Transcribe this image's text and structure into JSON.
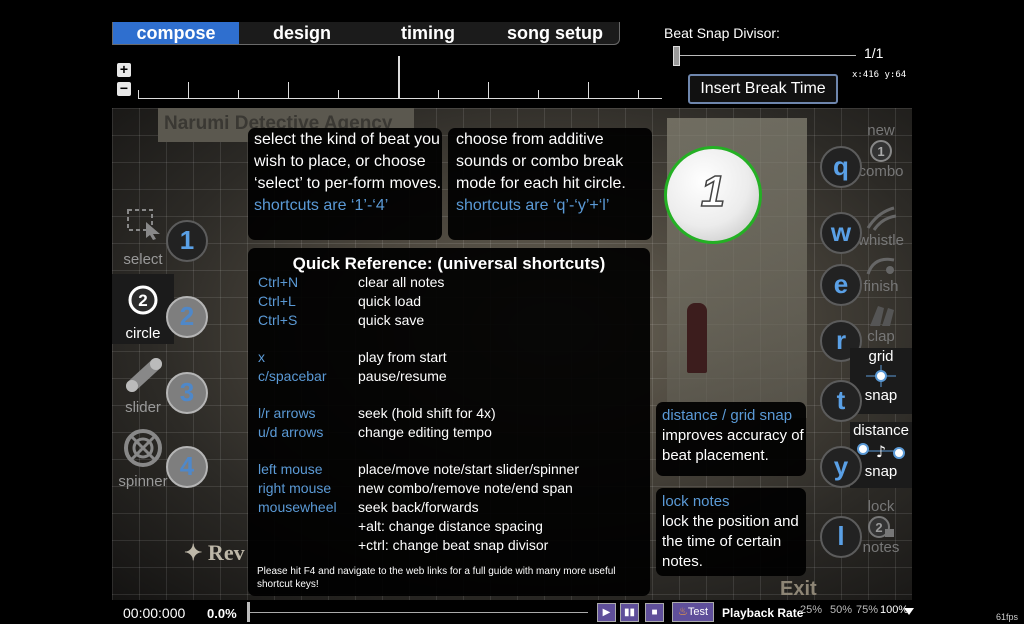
{
  "tabs": [
    {
      "label": "compose",
      "active": true
    },
    {
      "label": "design",
      "active": false
    },
    {
      "label": "timing",
      "active": false
    },
    {
      "label": "song setup",
      "active": false
    }
  ],
  "beat_snap": {
    "label": "Beat Snap Divisor:",
    "value": "1/1"
  },
  "coords": "x:416 y:64",
  "insert_break_label": "Insert Break Time",
  "zoom": {
    "in": "+",
    "out": "−"
  },
  "background": {
    "sign": "Narumi Detective Agency",
    "rev": "✦ Rev",
    "exit": "Exit"
  },
  "left_tools": [
    {
      "label": "select",
      "key": "1"
    },
    {
      "label": "circle",
      "key": "2"
    },
    {
      "label": "slider",
      "key": "3"
    },
    {
      "label": "spinner",
      "key": "4"
    }
  ],
  "right_tools": [
    {
      "top": "new",
      "bottom": "combo",
      "key": "q"
    },
    {
      "top": "",
      "bottom": "whistle",
      "key": "w"
    },
    {
      "top": "",
      "bottom": "finish",
      "key": "e"
    },
    {
      "top": "",
      "bottom": "clap",
      "key": "r"
    },
    {
      "top": "grid",
      "bottom": "snap",
      "key": "t"
    },
    {
      "top": "distance",
      "bottom": "snap",
      "key": "y"
    },
    {
      "top": "lock",
      "bottom": "notes",
      "key": "l"
    }
  ],
  "help_beat": {
    "text": "select the kind of beat you wish to place, or choose ‘select’ to per-form moves.",
    "shortcut": "shortcuts are ‘1’-‘4’"
  },
  "help_sounds": {
    "text": "choose from additive sounds or combo break mode for each hit circle.",
    "shortcut": "shortcuts are ‘q’-‘y’+‘l’"
  },
  "help_snap": {
    "title": "distance / grid snap",
    "text": "improves accuracy of beat placement."
  },
  "help_lock": {
    "title": "lock notes",
    "text": "lock the position and the time of certain notes."
  },
  "quick_ref": {
    "title": "Quick Reference: (universal shortcuts)",
    "rows": [
      {
        "key": "Ctrl+N",
        "action": "clear all notes"
      },
      {
        "key": "Ctrl+L",
        "action": "quick load"
      },
      {
        "key": "Ctrl+S",
        "action": "quick save"
      },
      {
        "key": "x",
        "action": "play from start"
      },
      {
        "key": "c/spacebar",
        "action": "pause/resume"
      },
      {
        "key": "l/r arrows",
        "action": "seek (hold shift for 4x)"
      },
      {
        "key": "u/d arrows",
        "action": "change editing tempo"
      },
      {
        "key": "left mouse",
        "action": "place/move note/start slider/spinner"
      },
      {
        "key": "right mouse",
        "action": "new combo/remove note/end span"
      },
      {
        "key": "mousewheel",
        "action": "seek back/forwards"
      },
      {
        "key": "",
        "action": "+alt: change distance spacing"
      },
      {
        "key": "",
        "action": "+ctrl: change beat snap divisor"
      }
    ],
    "footer": "Please hit F4 and navigate to the web links for a full guide with many more useful shortcut keys!"
  },
  "hit_circle_number": "1",
  "bottom": {
    "time": "00:00:000",
    "percent": "0.0%",
    "test_label": "Test",
    "playback_label": "Playback Rate",
    "rates": [
      "25%",
      "50%",
      "75%",
      "100%"
    ],
    "fps": "61fps"
  }
}
